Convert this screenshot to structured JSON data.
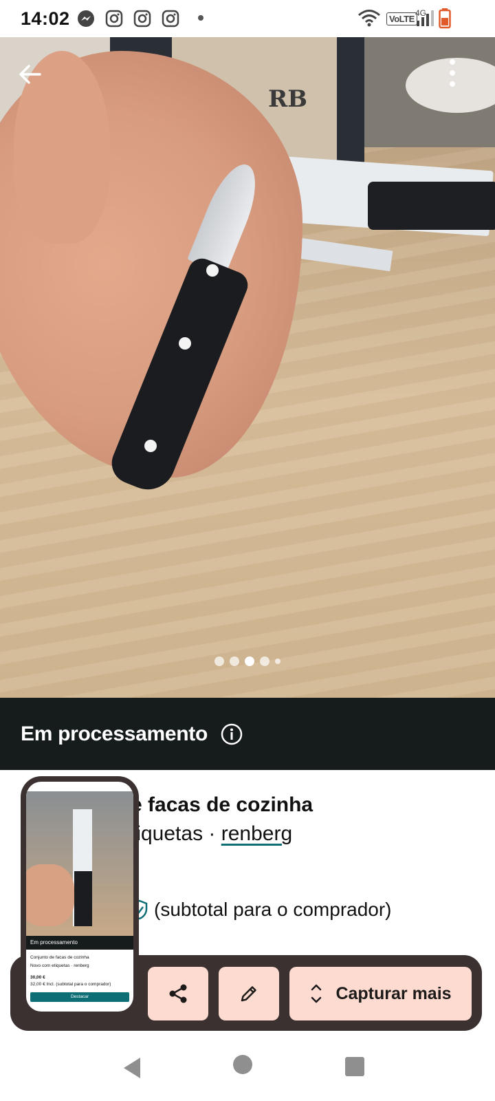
{
  "status_bar": {
    "time": "14:02",
    "icons": [
      "messenger-icon",
      "instagram-icon",
      "instagram-icon",
      "instagram-icon",
      "wifi-icon",
      "signal-icon",
      "battery-icon"
    ],
    "volte": "VoLTE",
    "network": "4G"
  },
  "photo": {
    "brand_logo_text": "RB",
    "page_indicator": {
      "count": 5,
      "active_index": 2
    }
  },
  "processing_banner": {
    "label": "Em processamento"
  },
  "listing": {
    "title_visible": "e facas de cozinha",
    "subtitle_visible": "tiquetas · ",
    "brand": "renberg",
    "price_note": "(subtotal para o comprador)"
  },
  "capture_toolbar": {
    "capture_more_label": "Capturar mais"
  },
  "thumbnail": {
    "processing": "Em processamento",
    "title": "Conjunto de facas de cozinha",
    "condition": "Novo com etiquetas · renberg",
    "price": "30,00 €",
    "price_incl": "32,00 € Incl. (subtotal para o comprador)",
    "button": "Destacar"
  },
  "colors": {
    "accent": "#0e6e76",
    "processing_bg": "#161b1c",
    "toolbar_bg": "#3b3131",
    "toolbar_button": "#fedbd0"
  }
}
